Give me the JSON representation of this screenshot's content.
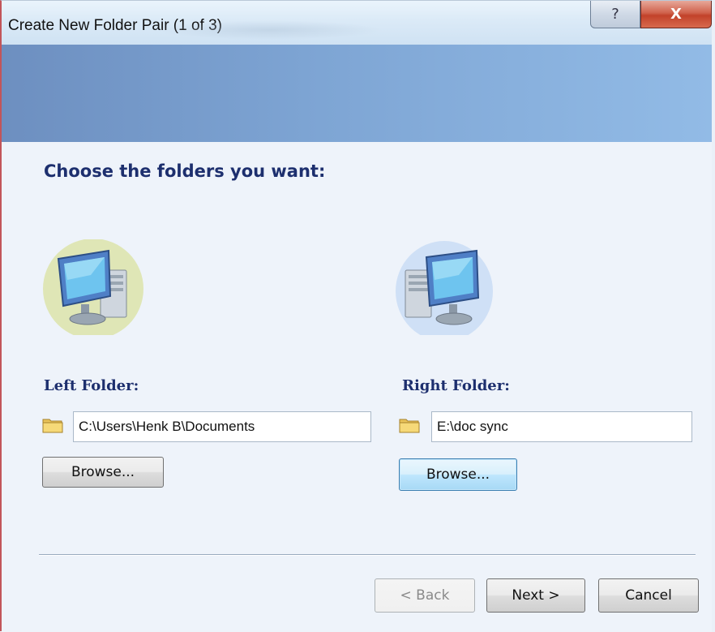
{
  "window": {
    "title": "Create New Folder Pair (1 of 3)",
    "help_glyph": "?",
    "close_glyph": "X"
  },
  "page": {
    "heading": "Choose the folders you want:"
  },
  "left": {
    "label": "Left Folder:",
    "path": "C:\\Users\\Henk B\\Documents",
    "browse_label": "Browse...",
    "icon": "computer-icon",
    "icon_bg": "#dfe6b6"
  },
  "right": {
    "label": "Right Folder:",
    "path": "E:\\doc sync",
    "browse_label": "Browse...",
    "icon": "computer-icon",
    "icon_bg": "#cfe0f6"
  },
  "footer": {
    "back_label": "< Back",
    "next_label": "Next >",
    "cancel_label": "Cancel"
  },
  "colors": {
    "heading": "#1d2f6e",
    "banner_start": "#6d8fc0",
    "banner_end": "#92bbe6",
    "close_button": "#c2422a"
  }
}
